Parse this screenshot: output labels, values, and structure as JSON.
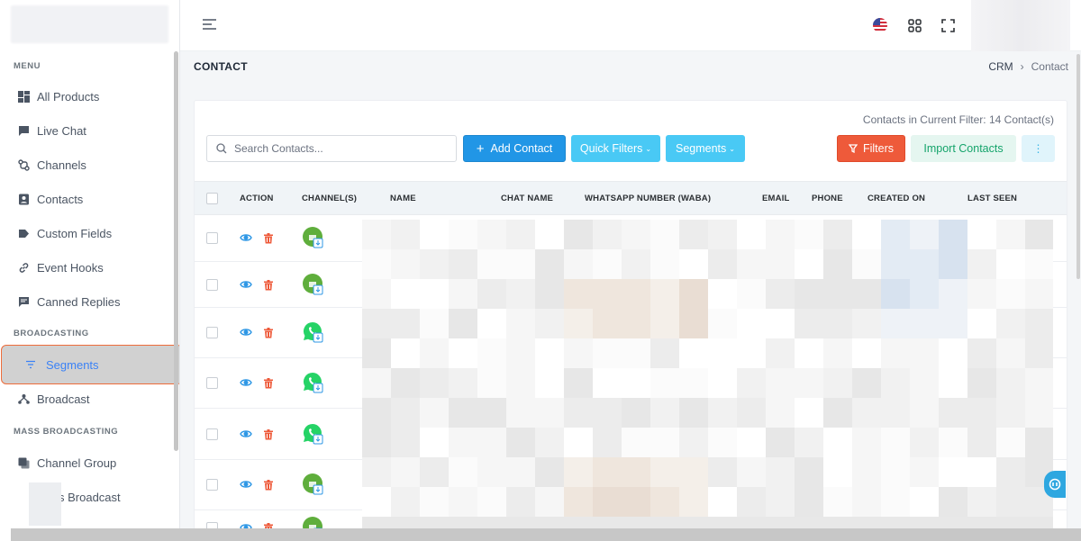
{
  "sidebar": {
    "sections": {
      "menu": "MENU",
      "broadcasting": "BROADCASTING",
      "mass_broadcasting": "MASS BROADCASTING"
    },
    "items": [
      {
        "label": "All Products",
        "icon": "dashboard-icon"
      },
      {
        "label": "Live Chat",
        "icon": "chat-icon"
      },
      {
        "label": "Channels",
        "icon": "channels-icon"
      },
      {
        "label": "Contacts",
        "icon": "contacts-icon"
      },
      {
        "label": "Custom Fields",
        "icon": "tag-icon"
      },
      {
        "label": "Event Hooks",
        "icon": "link-icon"
      },
      {
        "label": "Canned Replies",
        "icon": "message-icon"
      },
      {
        "label": "Segments",
        "icon": "filter-lines-icon",
        "active": true
      },
      {
        "label": "Broadcast",
        "icon": "broadcast-icon"
      },
      {
        "label": "Channel Group",
        "icon": "group-icon"
      },
      {
        "label": "s Broadcast",
        "icon": "mass-broadcast-icon"
      }
    ]
  },
  "topbar": {
    "icons": [
      "menu-icon",
      "us-flag-icon",
      "apps-grid-icon",
      "fullscreen-icon"
    ]
  },
  "page": {
    "title": "CONTACT",
    "breadcrumb": [
      "CRM",
      "Contact"
    ],
    "breadcrumb_sep": "›"
  },
  "toolbar": {
    "filter_count": "Contacts in Current Filter: 14 Contact(s)",
    "search_placeholder": "Search Contacts...",
    "add_contact": "Add Contact",
    "quick_filters": "Quick Filters",
    "segments": "Segments",
    "filters": "Filters",
    "import_contacts": "Import Contacts",
    "more": "⋮"
  },
  "table": {
    "columns": [
      "ACTION",
      "CHANNEL(S)",
      "NAME",
      "CHAT NAME",
      "WHATSAPP NUMBER (WABA)",
      "EMAIL",
      "PHONE",
      "CREATED ON",
      "LAST SEEN"
    ],
    "rows": [
      {
        "channel": "whatsapp-business"
      },
      {
        "channel": "whatsapp-business"
      },
      {
        "channel": "whatsapp"
      },
      {
        "channel": "whatsapp"
      },
      {
        "channel": "whatsapp"
      },
      {
        "channel": "whatsapp-business"
      },
      {
        "channel": "whatsapp-business"
      }
    ]
  },
  "colors": {
    "primary": "#2196e6",
    "info": "#49c9f5",
    "danger": "#ee5a3a",
    "success": "#15a46b",
    "whatsapp": "#25d366",
    "whatsapp_business": "#5fae3c",
    "active_outline": "#ee6c3a"
  }
}
